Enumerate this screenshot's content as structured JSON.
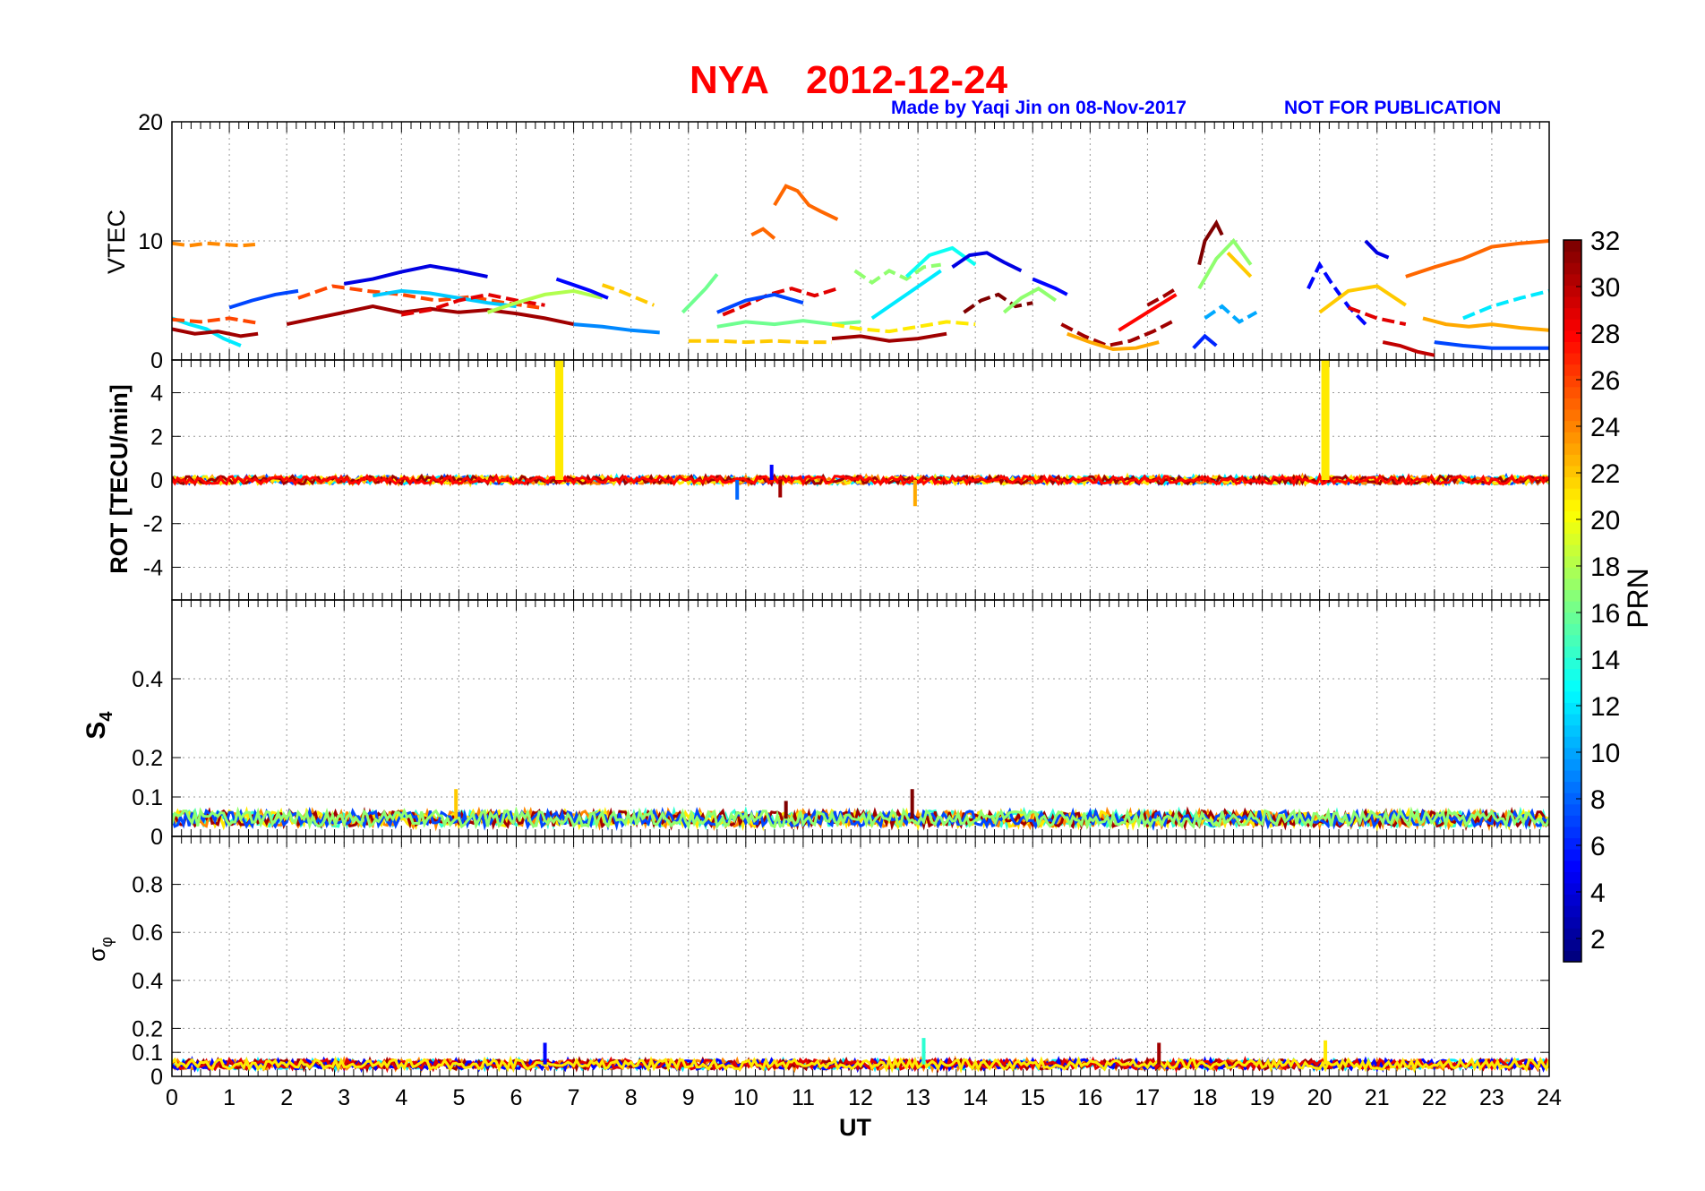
{
  "chart_data": {
    "type": "line",
    "title": {
      "station": "NYA",
      "date": "2012-12-24"
    },
    "credit": "Made by Yaqi Jin on 08-Nov-2017",
    "notice": "NOT FOR PUBLICATION",
    "xlabel": "UT",
    "xlim": [
      0,
      24
    ],
    "xticks": [
      "0",
      "1",
      "2",
      "3",
      "4",
      "5",
      "6",
      "7",
      "8",
      "9",
      "10",
      "11",
      "12",
      "13",
      "14",
      "15",
      "16",
      "17",
      "18",
      "19",
      "20",
      "21",
      "22",
      "23",
      "24"
    ],
    "grid": true,
    "colorbar": {
      "label": "PRN",
      "range": [
        1,
        32
      ],
      "ticks": [
        "2",
        "4",
        "6",
        "8",
        "10",
        "12",
        "14",
        "16",
        "18",
        "20",
        "22",
        "24",
        "26",
        "28",
        "30",
        "32"
      ],
      "colormap": "jet",
      "position": "right"
    },
    "colors": {
      "title": "#ff0000",
      "credit": "#0000ff"
    },
    "panels": [
      {
        "id": "vtec",
        "ylabel": "VTEC",
        "ylim": [
          0,
          20
        ],
        "yticks": [
          "0",
          "10",
          "20"
        ],
        "series": [
          {
            "prn": 24,
            "x": [
              0.0,
              0.3,
              0.6,
              0.9,
              1.2,
              1.45
            ],
            "y": [
              9.8,
              9.6,
              9.8,
              9.7,
              9.6,
              9.7
            ]
          },
          {
            "prn": 12,
            "x": [
              0.0,
              0.3,
              0.6,
              0.9,
              1.2
            ],
            "y": [
              3.5,
              3.0,
              2.6,
              1.8,
              1.2
            ]
          },
          {
            "prn": 31,
            "x": [
              0.0,
              0.4,
              0.8,
              1.2,
              1.5
            ],
            "y": [
              2.6,
              2.2,
              2.4,
              2.0,
              2.2
            ]
          },
          {
            "prn": 26,
            "x": [
              0.0,
              0.5,
              1.0,
              1.5
            ],
            "y": [
              3.4,
              3.2,
              3.5,
              3.1
            ]
          },
          {
            "prn": 7,
            "x": [
              1.0,
              1.4,
              1.8,
              2.2
            ],
            "y": [
              4.4,
              5.0,
              5.5,
              5.8
            ]
          },
          {
            "prn": 31,
            "x": [
              2.0,
              2.5,
              3.0,
              3.5,
              4.0,
              4.5,
              5.0,
              5.5,
              6.0,
              6.5,
              7.0
            ],
            "y": [
              3.0,
              3.5,
              4.0,
              4.5,
              4.0,
              4.3,
              4.0,
              4.2,
              3.9,
              3.5,
              3.0
            ]
          },
          {
            "prn": 26,
            "x": [
              2.2,
              2.8,
              3.4,
              4.0,
              4.6,
              5.2,
              5.8,
              6.4
            ],
            "y": [
              5.2,
              6.2,
              5.8,
              5.5,
              5.0,
              5.3,
              4.8,
              4.4
            ]
          },
          {
            "prn": 4,
            "x": [
              3.0,
              3.5,
              4.0,
              4.5,
              5.0,
              5.5
            ],
            "y": [
              6.4,
              6.8,
              7.4,
              7.9,
              7.5,
              7.0
            ]
          },
          {
            "prn": 11,
            "x": [
              3.5,
              4.0,
              4.5,
              5.0,
              5.5,
              6.0
            ],
            "y": [
              5.4,
              5.8,
              5.6,
              5.2,
              4.8,
              4.5
            ]
          },
          {
            "prn": 29,
            "x": [
              4.0,
              4.5,
              5.0,
              5.5,
              6.0,
              6.5
            ],
            "y": [
              3.8,
              4.2,
              5.0,
              5.5,
              5.0,
              4.6
            ]
          },
          {
            "prn": 18,
            "x": [
              5.5,
              6.0,
              6.5,
              7.0,
              7.5
            ],
            "y": [
              4.0,
              4.8,
              5.5,
              5.8,
              5.2
            ]
          },
          {
            "prn": 5,
            "x": [
              6.7,
              7.0,
              7.3,
              7.6
            ],
            "y": [
              6.8,
              6.3,
              5.8,
              5.2
            ]
          },
          {
            "prn": 22,
            "x": [
              7.5,
              7.8,
              8.1,
              8.4
            ],
            "y": [
              6.3,
              5.8,
              5.2,
              4.6
            ]
          },
          {
            "prn": 9,
            "x": [
              7.0,
              7.5,
              8.0,
              8.5
            ],
            "y": [
              3.0,
              2.8,
              2.5,
              2.3
            ]
          },
          {
            "prn": 16,
            "x": [
              8.9,
              9.1,
              9.3,
              9.5
            ],
            "y": [
              4.0,
              5.0,
              6.0,
              7.2
            ]
          },
          {
            "prn": 22,
            "x": [
              9.0,
              9.5,
              10.0,
              10.5,
              11.0,
              11.5
            ],
            "y": [
              1.6,
              1.6,
              1.5,
              1.6,
              1.5,
              1.5
            ]
          },
          {
            "prn": 25,
            "x": [
              10.1,
              10.3,
              10.5
            ],
            "y": [
              10.5,
              11.0,
              10.2
            ]
          },
          {
            "prn": 25,
            "x": [
              10.5,
              10.7,
              10.9,
              11.1,
              11.3,
              11.6
            ],
            "y": [
              13.0,
              14.6,
              14.2,
              13.0,
              12.5,
              11.8
            ]
          },
          {
            "prn": 29,
            "x": [
              9.6,
              10.0,
              10.4,
              10.8,
              11.2,
              11.6
            ],
            "y": [
              3.8,
              4.6,
              5.5,
              6.0,
              5.4,
              6.0
            ]
          },
          {
            "prn": 16,
            "x": [
              9.5,
              10.0,
              10.5,
              11.0,
              11.5,
              12.0
            ],
            "y": [
              2.8,
              3.2,
              3.0,
              3.3,
              3.0,
              3.2
            ]
          },
          {
            "prn": 7,
            "x": [
              9.5,
              10.0,
              10.5,
              11.0
            ],
            "y": [
              4.0,
              5.0,
              5.5,
              4.8
            ]
          },
          {
            "prn": 17,
            "x": [
              11.9,
              12.2,
              12.5,
              12.8,
              13.1,
              13.4
            ],
            "y": [
              7.5,
              6.5,
              7.5,
              6.8,
              7.8,
              8.0
            ]
          },
          {
            "prn": 12,
            "x": [
              12.2,
              12.5,
              12.8,
              13.1,
              13.4
            ],
            "y": [
              3.5,
              4.5,
              5.5,
              6.5,
              7.5
            ]
          },
          {
            "prn": 13,
            "x": [
              12.8,
              13.2,
              13.6,
              14.0
            ],
            "y": [
              7.0,
              8.8,
              9.4,
              8.0
            ]
          },
          {
            "prn": 21,
            "x": [
              11.5,
              12.0,
              12.5,
              13.0,
              13.5,
              14.0
            ],
            "y": [
              3.0,
              2.6,
              2.4,
              2.8,
              3.2,
              3.0
            ]
          },
          {
            "prn": 31,
            "x": [
              11.5,
              12.0,
              12.5,
              13.0,
              13.5
            ],
            "y": [
              1.8,
              2.0,
              1.6,
              1.8,
              2.2
            ]
          },
          {
            "prn": 4,
            "x": [
              13.6,
              13.9,
              14.2,
              14.5,
              14.8
            ],
            "y": [
              7.8,
              8.8,
              9.0,
              8.2,
              7.5
            ]
          },
          {
            "prn": 32,
            "x": [
              13.8,
              14.1,
              14.4,
              14.7,
              15.0
            ],
            "y": [
              4.0,
              5.0,
              5.5,
              4.5,
              4.8
            ]
          },
          {
            "prn": 17,
            "x": [
              14.5,
              14.8,
              15.1,
              15.4
            ],
            "y": [
              4.0,
              5.2,
              6.0,
              5.0
            ]
          },
          {
            "prn": 5,
            "x": [
              15.0,
              15.2,
              15.4,
              15.6
            ],
            "y": [
              6.8,
              6.4,
              6.0,
              5.5
            ]
          },
          {
            "prn": 31,
            "x": [
              15.5,
              15.9,
              16.3,
              16.7,
              17.1,
              17.5
            ],
            "y": [
              3.0,
              2.0,
              1.2,
              1.6,
              2.4,
              3.4
            ]
          },
          {
            "prn": 23,
            "x": [
              15.6,
              16.0,
              16.4,
              16.8,
              17.2
            ],
            "y": [
              2.2,
              1.5,
              0.9,
              1.0,
              1.5
            ]
          },
          {
            "prn": 28,
            "x": [
              16.5,
              17.0,
              17.5
            ],
            "y": [
              2.5,
              4.0,
              5.5
            ]
          },
          {
            "prn": 31,
            "x": [
              17.0,
              17.3,
              17.5
            ],
            "y": [
              4.6,
              5.4,
              6.0
            ]
          },
          {
            "prn": 17,
            "x": [
              17.9,
              18.2,
              18.5,
              18.8
            ],
            "y": [
              6.0,
              8.5,
              10.0,
              8.0
            ]
          },
          {
            "prn": 32,
            "x": [
              17.9,
              18.0,
              18.2,
              18.3
            ],
            "y": [
              8.0,
              10.0,
              11.5,
              10.5
            ]
          },
          {
            "prn": 10,
            "x": [
              18.0,
              18.3,
              18.6,
              18.9
            ],
            "y": [
              3.5,
              4.5,
              3.2,
              4.0
            ]
          },
          {
            "prn": 22,
            "x": [
              18.4,
              18.6,
              18.8
            ],
            "y": [
              9.0,
              8.0,
              7.0
            ]
          },
          {
            "prn": 6,
            "x": [
              17.8,
              18.0,
              18.2
            ],
            "y": [
              1.0,
              2.0,
              1.2
            ]
          },
          {
            "prn": 5,
            "x": [
              19.8,
              20.0,
              20.2,
              20.5,
              20.8
            ],
            "y": [
              6.0,
              8.0,
              6.5,
              4.5,
              3.0
            ]
          },
          {
            "prn": 4,
            "x": [
              20.8,
              21.0,
              21.2
            ],
            "y": [
              10.0,
              9.0,
              8.6
            ]
          },
          {
            "prn": 22,
            "x": [
              20.0,
              20.5,
              21.0,
              21.5
            ],
            "y": [
              4.0,
              5.8,
              6.2,
              4.6
            ]
          },
          {
            "prn": 29,
            "x": [
              20.5,
              21.0,
              21.5
            ],
            "y": [
              4.4,
              3.5,
              3.0
            ]
          },
          {
            "prn": 25,
            "x": [
              21.5,
              22.0,
              22.5,
              23.0,
              23.5,
              24.0
            ],
            "y": [
              7.0,
              7.8,
              8.5,
              9.5,
              9.8,
              10.0
            ]
          },
          {
            "prn": 30,
            "x": [
              21.1,
              21.4,
              21.7,
              22.0
            ],
            "y": [
              1.5,
              1.2,
              0.7,
              0.4
            ]
          },
          {
            "prn": 12,
            "x": [
              22.5,
              23.0,
              23.5,
              24.0
            ],
            "y": [
              3.5,
              4.5,
              5.2,
              5.8
            ]
          },
          {
            "prn": 23,
            "x": [
              21.8,
              22.2,
              22.6,
              23.0,
              23.5,
              24.0
            ],
            "y": [
              3.5,
              3.0,
              2.8,
              3.0,
              2.7,
              2.5
            ]
          },
          {
            "prn": 7,
            "x": [
              22.0,
              22.5,
              23.0,
              23.5,
              24.0
            ],
            "y": [
              1.5,
              1.2,
              1.0,
              1.0,
              1.0
            ]
          }
        ]
      },
      {
        "id": "rot",
        "ylabel": "ROT [TECU/min]",
        "ylim": [
          -5.5,
          5.5
        ],
        "yticks": [
          "-4",
          "-2",
          "0",
          "2",
          "4"
        ],
        "spikes": [
          {
            "prn": 21,
            "x": 6.75,
            "y": 5.5
          },
          {
            "prn": 21,
            "x": 20.1,
            "y": 5.5
          }
        ],
        "dips": [
          {
            "prn": 31,
            "x": 10.6,
            "y": -0.8
          },
          {
            "prn": 8,
            "x": 9.85,
            "y": -0.9
          },
          {
            "prn": 23,
            "x": 12.95,
            "y": -1.2
          },
          {
            "prn": 5,
            "x": 10.45,
            "y": 0.7
          }
        ],
        "series_prns": [
          7,
          12,
          24,
          21,
          31,
          28
        ],
        "baseline": 0.0,
        "noise": 0.18
      },
      {
        "id": "s4",
        "ylabel": "S4",
        "ylim": [
          0,
          0.6
        ],
        "yticks": [
          "0",
          "0.1",
          "0.2",
          "0.4"
        ],
        "series_prns": [
          14,
          24,
          21,
          31,
          7,
          17
        ],
        "baseline": 0.045,
        "noise": 0.02,
        "peaks": [
          {
            "prn": 32,
            "x": 12.9,
            "y": 0.12
          },
          {
            "prn": 22,
            "x": 4.95,
            "y": 0.12
          },
          {
            "prn": 32,
            "x": 10.7,
            "y": 0.09
          }
        ]
      },
      {
        "id": "sigma_phi",
        "ylabel": "σφ",
        "ylim": [
          0,
          1.0
        ],
        "yticks": [
          "0",
          "0.1",
          "0.2",
          "0.4",
          "0.6",
          "0.8"
        ],
        "series_prns": [
          12,
          24,
          31,
          5,
          29,
          21
        ],
        "baseline": 0.05,
        "noise": 0.02,
        "peaks": [
          {
            "prn": 14,
            "x": 13.1,
            "y": 0.16
          },
          {
            "prn": 21,
            "x": 20.1,
            "y": 0.15
          },
          {
            "prn": 31,
            "x": 17.2,
            "y": 0.14
          },
          {
            "prn": 5,
            "x": 6.5,
            "y": 0.14
          }
        ]
      }
    ]
  }
}
